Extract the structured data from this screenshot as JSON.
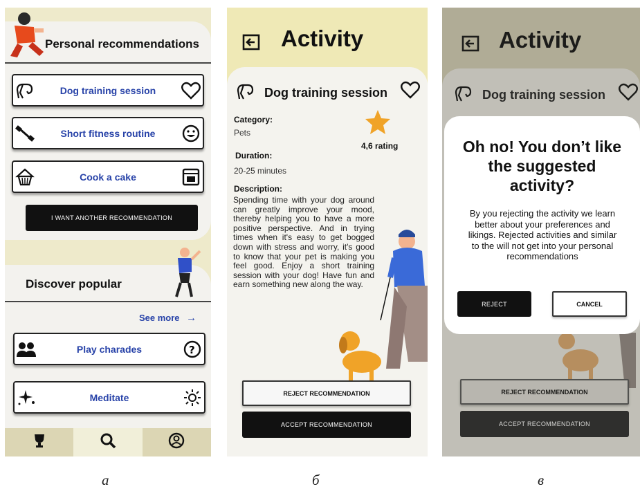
{
  "panel_a": {
    "section_title": "Personal recommendations",
    "recommendations": [
      {
        "label": "Dog training session",
        "icon": "dog-head-icon",
        "action_icon": "heart-icon"
      },
      {
        "label": "Short fitness routine",
        "icon": "dumbbell-icon",
        "action_icon": "smiley-icon"
      },
      {
        "label": "Cook a cake",
        "icon": "cupcake-icon",
        "action_icon": "oven-icon"
      }
    ],
    "another_button": "I WANT ANOTHER RECOMMENDATION",
    "popular_title": "Discover popular",
    "see_more": "See more",
    "popular": [
      {
        "label": "Play charades",
        "icon": "people-icon",
        "action_icon": "question-icon"
      },
      {
        "label": "Meditate",
        "icon": "sparkles-icon",
        "action_icon": "sun-icon"
      }
    ],
    "tabs": [
      "trophy-icon",
      "search-icon",
      "profile-icon"
    ],
    "active_tab": 1
  },
  "panel_b": {
    "title": "Activity",
    "activity_name": "Dog training session",
    "category_label": "Category:",
    "category_value": "Pets",
    "rating": "4,6 rating",
    "duration_label": "Duration:",
    "duration_value": "20-25 minutes",
    "description_label": "Description:",
    "description": "Spending time with your dog around can greatly improve your mood, thereby helping you to have a more positive perspective. And in trying times when it's easy to get bogged down with stress and worry, it's good to know that your pet is making you feel good. Enjoy a short training session with your dog! Have fun and earn something new along the way.",
    "reject_button": "REJECT RECOMMENDATION",
    "accept_button": "ACCEPT RECOMMENDATION"
  },
  "panel_c": {
    "title": "Activity",
    "activity_name": "Dog training session",
    "modal_title": "Oh no! You don’t like the suggested activity?",
    "modal_text": "By you rejecting the activity we learn better about your preferences and likings. Rejected activities and similar to the will not get into your personal recommendations",
    "reject": "REJECT",
    "cancel": "CANCEL",
    "reject_button": "REJECT RECOMMENDATION",
    "accept_button": "ACCEPT RECOMMENDATION"
  },
  "captions": [
    "а",
    "б",
    "в"
  ],
  "colors": {
    "accent_blue": "#2742a8",
    "panel_yellow": "#efe9b6",
    "star": "#f0a328"
  }
}
